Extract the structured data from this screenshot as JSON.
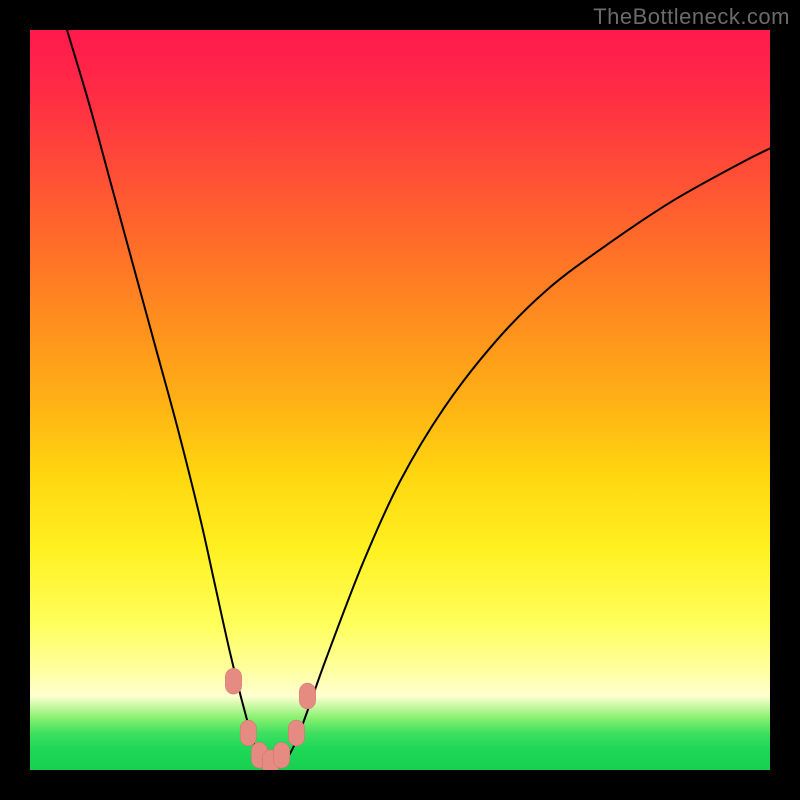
{
  "attribution": "TheBottleneck.com",
  "chart_data": {
    "type": "line",
    "title": "",
    "xlabel": "",
    "ylabel": "",
    "xlim": [
      0,
      100
    ],
    "ylim": [
      0,
      100
    ],
    "background": "red-yellow-green vertical gradient",
    "series": [
      {
        "name": "bottleneck-curve",
        "x": [
          5,
          8,
          11,
          14,
          17,
          20,
          23,
          25,
          27,
          29,
          30.5,
          32,
          34,
          36,
          40,
          45,
          50,
          56,
          63,
          70,
          78,
          87,
          96,
          100
        ],
        "y": [
          100,
          90,
          79,
          68,
          57,
          46,
          34,
          25,
          16,
          8,
          3,
          1,
          1,
          4,
          15,
          28,
          39,
          49,
          58,
          65,
          71,
          77,
          82,
          84
        ]
      }
    ],
    "markers": [
      {
        "x": 27.5,
        "y": 12
      },
      {
        "x": 29.5,
        "y": 5
      },
      {
        "x": 31.0,
        "y": 2
      },
      {
        "x": 32.5,
        "y": 1
      },
      {
        "x": 34.0,
        "y": 2
      },
      {
        "x": 36.0,
        "y": 5
      },
      {
        "x": 37.5,
        "y": 10
      }
    ],
    "marker_style": {
      "shape": "rounded-rect",
      "color": "#e58b82",
      "width": 2.2,
      "height": 3.5
    },
    "min_vertex": {
      "x": 33,
      "y": 0.5
    }
  }
}
